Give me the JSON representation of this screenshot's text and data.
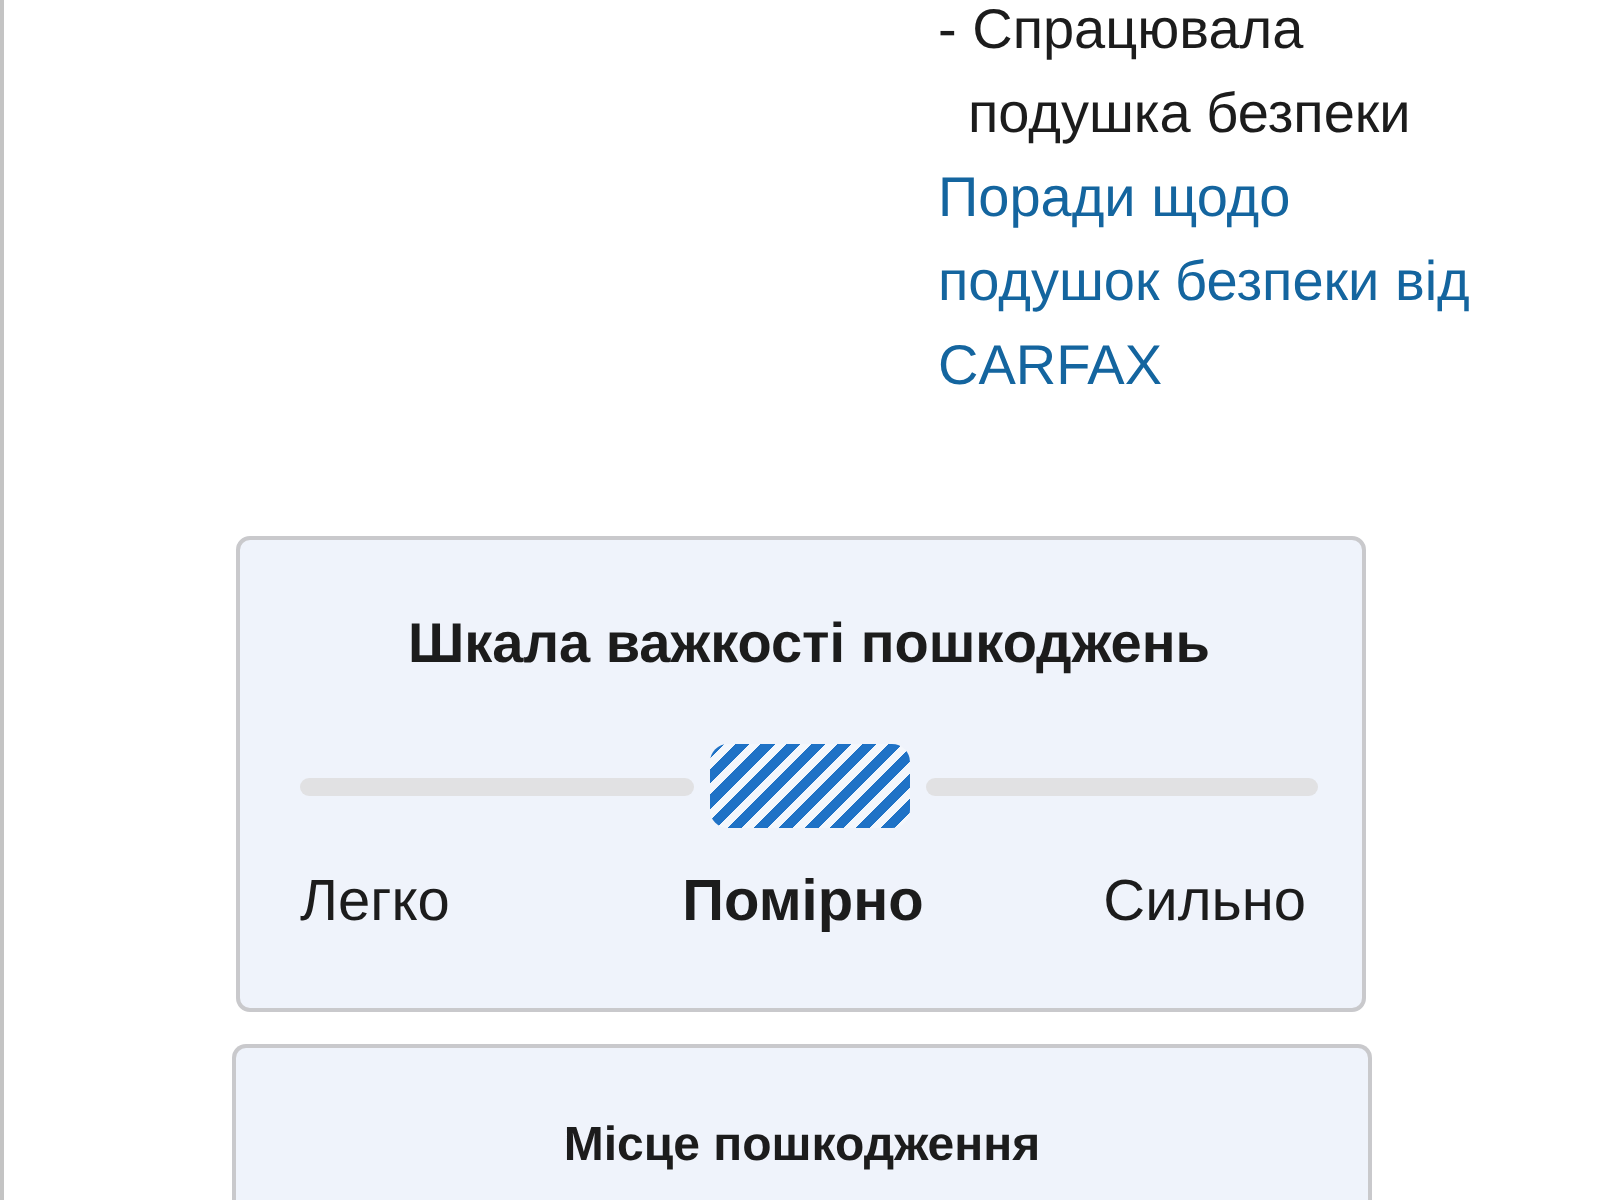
{
  "airbag_note": {
    "text": "- Спрацювала подушка безпеки"
  },
  "tips_link": {
    "text": "Поради щодо подушок безпеки від CARFAX"
  },
  "severity_card": {
    "title": "Шкала важкості пошкоджень",
    "levels": [
      {
        "label": "Легко",
        "selected": false
      },
      {
        "label": "Помірно",
        "selected": true
      },
      {
        "label": "Сильно",
        "selected": false
      }
    ]
  },
  "location_card": {
    "title": "Місце пошкодження"
  }
}
